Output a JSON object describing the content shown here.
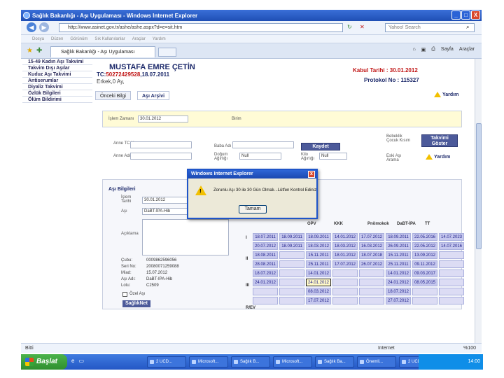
{
  "window": {
    "title": "Sağlık Bakanlığı - Aşı Uygulaması - Windows Internet Explorer",
    "minimize": "_",
    "maximize": "□",
    "close": "X"
  },
  "browser": {
    "address": "http://www.asinet.gov.tr/ashe/ashe.aspx?d=e=sit.htm",
    "search_placeholder": "Yahoo! Search",
    "menu": [
      "Dosya",
      "Düzen",
      "Görünüm",
      "Sık Kullanılanlar",
      "Araçlar",
      "Yardım"
    ],
    "tab_title": "Sağlık Bakanlığı - Aşı Uygulaması",
    "tools": [
      "Sayfa",
      "Araçlar"
    ]
  },
  "sidebar": {
    "items": [
      "15-49 Kadın Aşı Takvimi",
      "Takvim Dışı Aşılar",
      "Kuduz Aşı Takvimi",
      "Antiserumlar",
      "Diyaliz Takvimi",
      "Özlük Bilgileri",
      "Ölüm Bildirimi"
    ]
  },
  "patient": {
    "name": "MUSTAFA EMRE ÇETİN",
    "tc_label": "TC:",
    "tc_value": "50272429528",
    "birth": ",18.07.2011",
    "sex": "Erkek,0 Ay,",
    "kabul": "Kabul Tarihi : 30.01.2012",
    "protokol": "Protokol No : 115327"
  },
  "tabs": [
    "Önceki Bilgi",
    "Aşı Arşivi"
  ],
  "help_label": "Yardım",
  "form": {
    "tarih_label": "İşlem Zamanı",
    "tarih_value": "30.01.2012",
    "birim_label": "Birim",
    "anne_tc_label": "Anne TC No",
    "baba_adi_label": "Baba Adı",
    "anne_adi_label": "Anne Adı",
    "dogum_agirligi_label": "Doğum Ağırlığı",
    "dogum_agirligi_value": "Null",
    "kilo_label": "Kilo Ağırlığı",
    "kilo_value": "Null",
    "kaydet": "Kaydet",
    "radio1": "Bebeklik Çocuk Kısım",
    "radio2": "Eski Aşı Arama",
    "takvim_goster": "Takvimi Göster"
  },
  "asi": {
    "header": "Aşı Bilgileri",
    "islem_tarihi_label": "İşlem Tarihi",
    "islem_tarihi_value": "30.01.2012",
    "asi_label": "Aşı",
    "asi_value": "DaBT-İPA-Hib",
    "aciklama_label": "Açıklama",
    "info_labels": [
      "Çubu:",
      "Seri No:",
      "Miad:",
      "Aşı Adı:",
      "Lotu:"
    ],
    "info_values": [
      "0009862596056",
      "20080071259088",
      "15.07.2012",
      "DaBT-IPA-Hib",
      "C2509"
    ],
    "ozel_asi": "Özel Aşı",
    "sagliknet": "SağlıkNet"
  },
  "grid": {
    "columns": [
      "OPV",
      "KKK",
      "Pnömokok",
      "DaBT-İPA",
      "TT"
    ],
    "row_labels": [
      "I",
      "II",
      "III",
      "R/EV"
    ],
    "cells": [
      [
        "18.07.2011",
        "18.09.2011",
        "18.09.2011",
        "14.01.2012",
        "17.07.2012",
        "18.09.2011",
        "22.05.2016",
        "14.07.2023"
      ],
      [
        "20.07.2012",
        "18.09.2011",
        "18.03.2012",
        "18.03.2012",
        "16.03.2012",
        "26.09.2011",
        "22.05.2012",
        "14.07.2016"
      ],
      [
        "18.08.2011",
        "",
        "15.11.2011",
        "18.01.2012",
        "18.07.2018",
        "15.11.2011",
        "13.09.2012",
        ""
      ],
      [
        "28.08.2011",
        "",
        "25.11.2011",
        "17.07.2012",
        "26.07.2012",
        "25.11.2011",
        "09.11.2012",
        ""
      ],
      [
        "18.07.2012",
        "",
        "14.01.2012",
        "",
        "",
        "14.01.2012",
        "09.03.2017",
        ""
      ],
      [
        "24.01.2012",
        "",
        "24.01.2012",
        "",
        "",
        "24.01.2012",
        "08.05.2015",
        ""
      ],
      [
        "",
        "",
        "08.03.2012",
        "",
        "",
        "18.07.2012",
        "",
        ""
      ],
      [
        "",
        "",
        "17.07.2012",
        "",
        "",
        "27.07.2012",
        "",
        ""
      ]
    ]
  },
  "dialog": {
    "title": "Windows Internet Explorer",
    "message": "Zorunlu Aşı 30 ile 30 Gün Olmalı...Lütfen Kontrol Ediniz",
    "ok": "Tamam"
  },
  "status": {
    "left": "Bitti",
    "zone": "Internet",
    "zoom": "%100"
  },
  "taskbar": {
    "start": "Başlat",
    "tasks": [
      "2 UCD...",
      "Microsoft...",
      "Sağlık B...",
      "Microsoft...",
      "Sağlık Ba...",
      "Önemli...",
      "2 UCD..."
    ],
    "clock": "14:00"
  }
}
